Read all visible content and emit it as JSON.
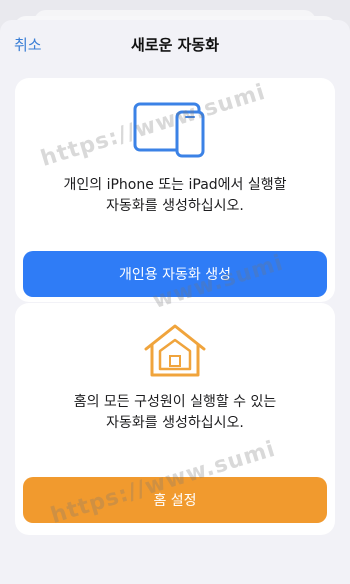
{
  "nav": {
    "cancel_label": "취소",
    "title": "새로운 자동화"
  },
  "personal": {
    "description": "개인의 iPhone 또는 iPad에서 실행할\n자동화를 생성하십시오.",
    "button_label": "개인용 자동화 생성"
  },
  "home": {
    "description": "홈의 모든 구성원이 실행할 수 있는\n자동화를 생성하십시오.",
    "button_label": "홈 설정"
  },
  "watermark": {
    "text_1": "https://www.sumi",
    "text_2": "www.sumi",
    "text_3": "https://www.sumi",
    "text_4": "https://www.sumi"
  },
  "colors": {
    "accent_blue": "#2f7cf6",
    "accent_orange": "#f19a2e",
    "link_blue": "#3b7fd6",
    "device_icon_blue": "#3b82e6",
    "home_icon_orange": "#f0a43c"
  },
  "icons": {
    "personal": "devices-icon",
    "home": "home-icon"
  }
}
